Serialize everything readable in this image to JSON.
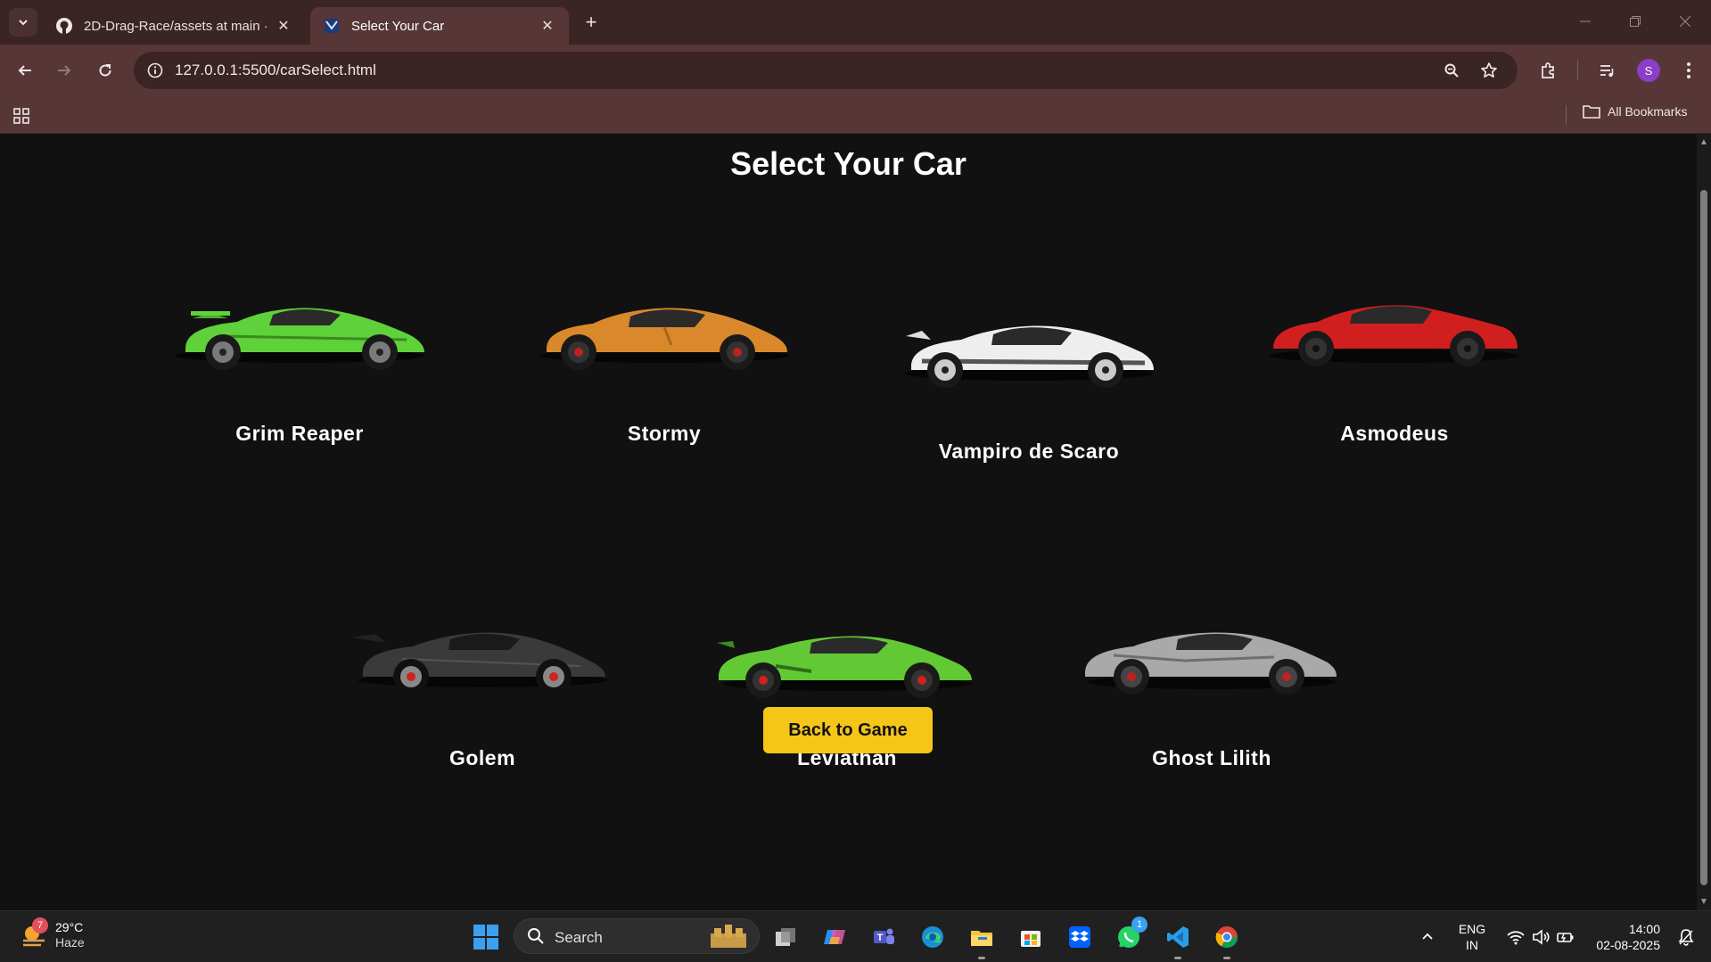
{
  "browser": {
    "tabs": [
      {
        "title": "2D-Drag-Race/assets at main · ",
        "favicon": "github-icon",
        "active": false
      },
      {
        "title": "Select Your Car",
        "favicon": "site-icon",
        "active": true
      }
    ],
    "url": "127.0.0.1:5500/carSelect.html",
    "profile_initial": "S",
    "bookmarks_label": "All Bookmarks"
  },
  "page": {
    "heading": "Select Your Car",
    "cars": [
      {
        "name": "Grim Reaper",
        "color": "#5fd13a"
      },
      {
        "name": "Stormy",
        "color": "#d9892b"
      },
      {
        "name": "Vampiro de Scaro",
        "color": "#eeeeee"
      },
      {
        "name": "Asmodeus",
        "color": "#d11f1f"
      },
      {
        "name": "Golem",
        "color": "#3a3a3a"
      },
      {
        "name": "Leviathan",
        "color": "#62c934"
      },
      {
        "name": "Ghost Lilith",
        "color": "#a9a9a9"
      }
    ],
    "back_button": "Back to Game",
    "accent": "#f5c518"
  },
  "taskbar": {
    "weather_badge": "7",
    "temperature": "29°C",
    "condition": "Haze",
    "search_label": "Search",
    "language": "ENG",
    "region": "IN",
    "time": "14:00",
    "date": "02-08-2025",
    "whatsapp_badge": "1"
  }
}
